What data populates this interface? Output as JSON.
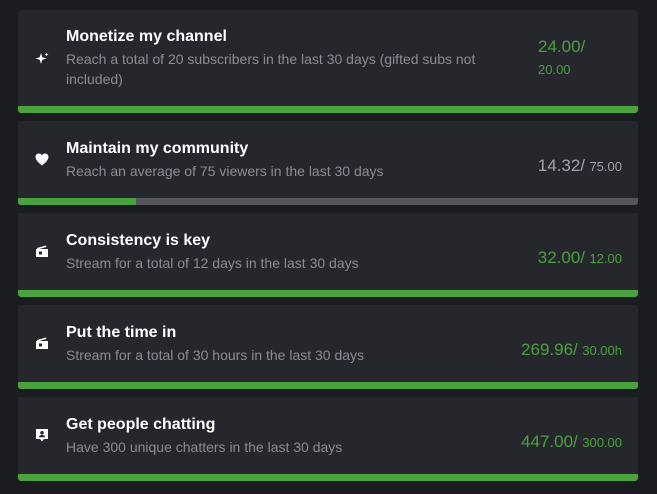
{
  "goals": [
    {
      "title": "Monetize my channel",
      "description": "Reach a total of 20 subscribers in the last 30 days (gifted subs not included)",
      "current": "24.00/",
      "target": "20.00",
      "progress": 1.0,
      "icon": "sparkle-icon",
      "value_color": "#4aa23f"
    },
    {
      "title": "Maintain my community",
      "description": "Reach an average of 75 viewers in the last 30 days",
      "current": "14.32/",
      "target": "75.00",
      "progress": 0.19,
      "icon": "heart-icon",
      "value_color": "#a2a4ab"
    },
    {
      "title": "Consistency is key",
      "description": "Stream for a total of 12 days in the last 30 days",
      "current": "32.00/",
      "target": "12.00",
      "progress": 1.0,
      "icon": "video-camera-icon",
      "value_color": "#4aa23f"
    },
    {
      "title": "Put the time in",
      "description": "Stream for a total of 30 hours in the last 30 days",
      "current": "269.96/",
      "target": "30.00h",
      "progress": 1.0,
      "icon": "video-camera-icon",
      "value_color": "#4aa23f"
    },
    {
      "title": "Get people chatting",
      "description": "Have 300 unique chatters in the last 30 days",
      "current": "447.00/",
      "target": "300.00",
      "progress": 1.0,
      "icon": "chat-user-icon",
      "value_color": "#4aa23f"
    }
  ],
  "colors": {
    "progress_fill": "#4aa23f",
    "progress_track": "#55575d",
    "card_bg": "#26272c",
    "page_bg": "#1b1c1f"
  }
}
